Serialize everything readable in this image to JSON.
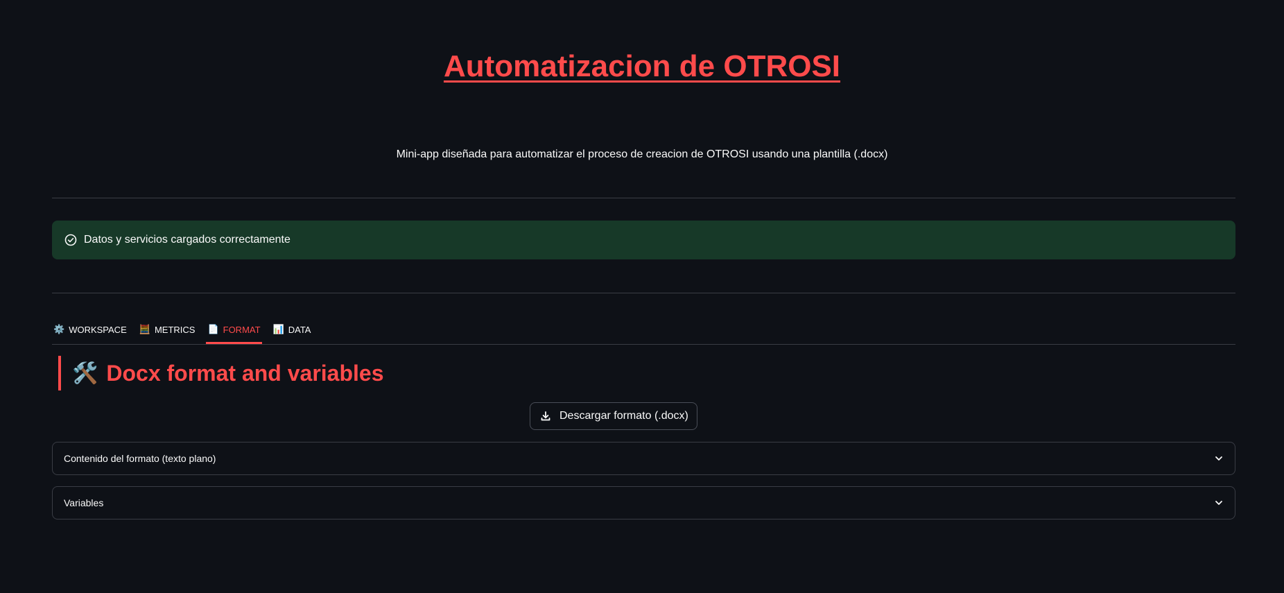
{
  "header": {
    "title": "Automatizacion de OTROSI",
    "subtitle": "Mini-app diseñada para automatizar el proceso de creacion de OTROSI usando una plantilla (.docx)"
  },
  "alert": {
    "icon": "check-circle-icon",
    "text": "Datos y servicios cargados correctamente",
    "color": "#173928"
  },
  "tabs": [
    {
      "icon": "⚙️",
      "icon_name": "gear-icon",
      "label": "WORKSPACE",
      "active": false
    },
    {
      "icon": "🧮",
      "icon_name": "abacus-icon",
      "label": "METRICS",
      "active": false
    },
    {
      "icon": "📄",
      "icon_name": "document-icon",
      "label": "FORMAT",
      "active": true
    },
    {
      "icon": "📊",
      "icon_name": "bar-chart-icon",
      "label": "DATA",
      "active": false
    }
  ],
  "section": {
    "icon": "🛠️",
    "title": "Docx format and variables"
  },
  "download": {
    "icon": "download-icon",
    "label": "Descargar formato (.docx)"
  },
  "expanders": [
    {
      "label": "Contenido del formato (texto plano)",
      "expanded": false
    },
    {
      "label": "Variables",
      "expanded": false
    }
  ],
  "colors": {
    "background": "#0e1117",
    "accent": "#ff4b4b",
    "success": "#173928",
    "border": "#3a3d45"
  }
}
